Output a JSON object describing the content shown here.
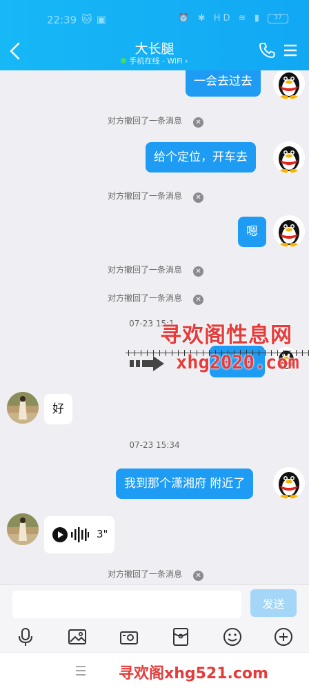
{
  "status_bar": {
    "time": "22:39",
    "icons": [
      "cat-icon",
      "camera-app-icon"
    ],
    "right_icons": [
      "alarm-icon",
      "bluetooth-icon",
      "hd-icon",
      "wifi-icon",
      "signal-icon"
    ],
    "battery": "37"
  },
  "header": {
    "title": "大长腿",
    "online_status": "手机在线 - WiFi",
    "chevron": "›",
    "accent": "#16b8f6"
  },
  "messages": [
    {
      "type": "sent",
      "text": "一会去过去"
    },
    {
      "type": "notice",
      "text": "对方撤回了一条消息"
    },
    {
      "type": "sent",
      "text": "给个定位，开车去"
    },
    {
      "type": "notice",
      "text": "对方撤回了一条消息"
    },
    {
      "type": "sent",
      "text": "嗯"
    },
    {
      "type": "notice",
      "text": "对方撤回了一条消息"
    },
    {
      "type": "notice",
      "text": "对方撤回了一条消息"
    },
    {
      "type": "time",
      "text": "07-23 15:1"
    },
    {
      "type": "received",
      "text": "好"
    },
    {
      "type": "time",
      "text": "07-23 15:34"
    },
    {
      "type": "sent",
      "text": "我到那个潇湘府 附近了"
    },
    {
      "type": "voice",
      "duration": "3\""
    },
    {
      "type": "notice",
      "text": "对方撤回了一条消息"
    }
  ],
  "notice_close": "✕",
  "watermark": {
    "title": "寻欢阁性息网",
    "url": "xhg2020.com",
    "footer": "寻欢阁xhg521.com",
    "color": "#e53b3b"
  },
  "composer": {
    "input_value": "",
    "send_label": "发送"
  },
  "toolbar_icons": [
    "microphone-icon",
    "image-icon",
    "camera-icon",
    "red-packet-icon",
    "emoji-icon",
    "plus-icon"
  ],
  "colors": {
    "sent_bubble": "#1e9bf3",
    "received_bubble": "#ffffff",
    "background": "#efeff3",
    "send_button": "#a4d6f8"
  }
}
